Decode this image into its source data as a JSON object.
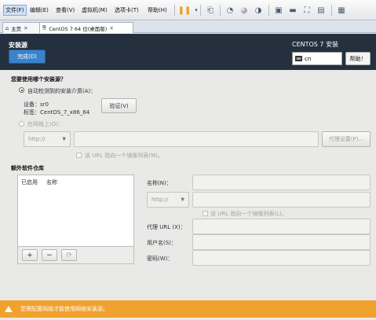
{
  "vm": {
    "menu": [
      "文件(F)",
      "编辑(E)",
      "查看(V)",
      "虚拟机(M)",
      "选项卡(T)",
      "帮助(H)"
    ],
    "tabs": [
      {
        "label": "主页"
      },
      {
        "label": "CentOS 7 64 位(桌面版)"
      }
    ]
  },
  "header": {
    "title": "安装源",
    "done_label": "完成(D)",
    "product": "CENTOS 7 安装",
    "keyboard_value": "cn",
    "help_label": "帮助！"
  },
  "source": {
    "question": "您要使用哪个安装源？",
    "auto_label": "自动检测到的安装介质(A)：",
    "device_line": "设备：sr0",
    "label_line": "标签：CentOS_7_x86_64",
    "verify_label": "验证(V)",
    "network_label": "在网络上(O)：",
    "protocol": "http://",
    "mirror_check_label": "该 URL 指向一个镜像列表(M)。",
    "proxy_label": "代理设置(P)..."
  },
  "repos": {
    "section_title": "额外软件仓库",
    "col_enabled": "已启用",
    "col_name": "名称",
    "name_label": "名称(N)：",
    "protocol": "http://",
    "mirror_check_label": "该 URL 指向一个镜像列表(L)。",
    "proxy_url_label": "代理 URL (X)：",
    "username_label": "用户名(S)：",
    "password_label": "密码(W)："
  },
  "warning": {
    "text": "您需配置网络才能使用网络安装源。",
    "color": "#f0a12e"
  },
  "colors": {
    "header_bg": "#24303d",
    "accent": "#3b83c9"
  }
}
